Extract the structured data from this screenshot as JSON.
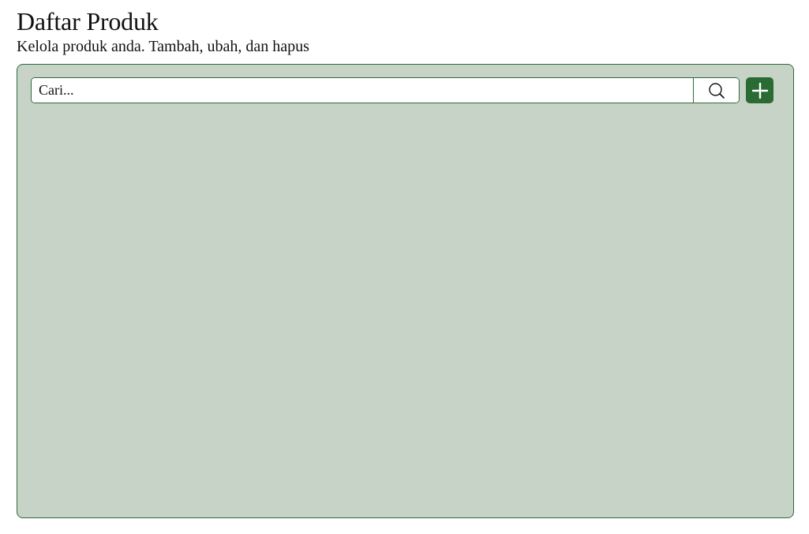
{
  "header": {
    "title": "Daftar Produk",
    "subtitle": "Kelola produk anda. Tambah, ubah, dan hapus"
  },
  "toolbar": {
    "search_placeholder": "Cari...",
    "search_value": "",
    "search_icon": "search-icon",
    "add_icon": "plus-icon"
  },
  "colors": {
    "accent": "#2a6b34",
    "panel_background": "#c8d3c8",
    "border": "#2e6b3a"
  }
}
